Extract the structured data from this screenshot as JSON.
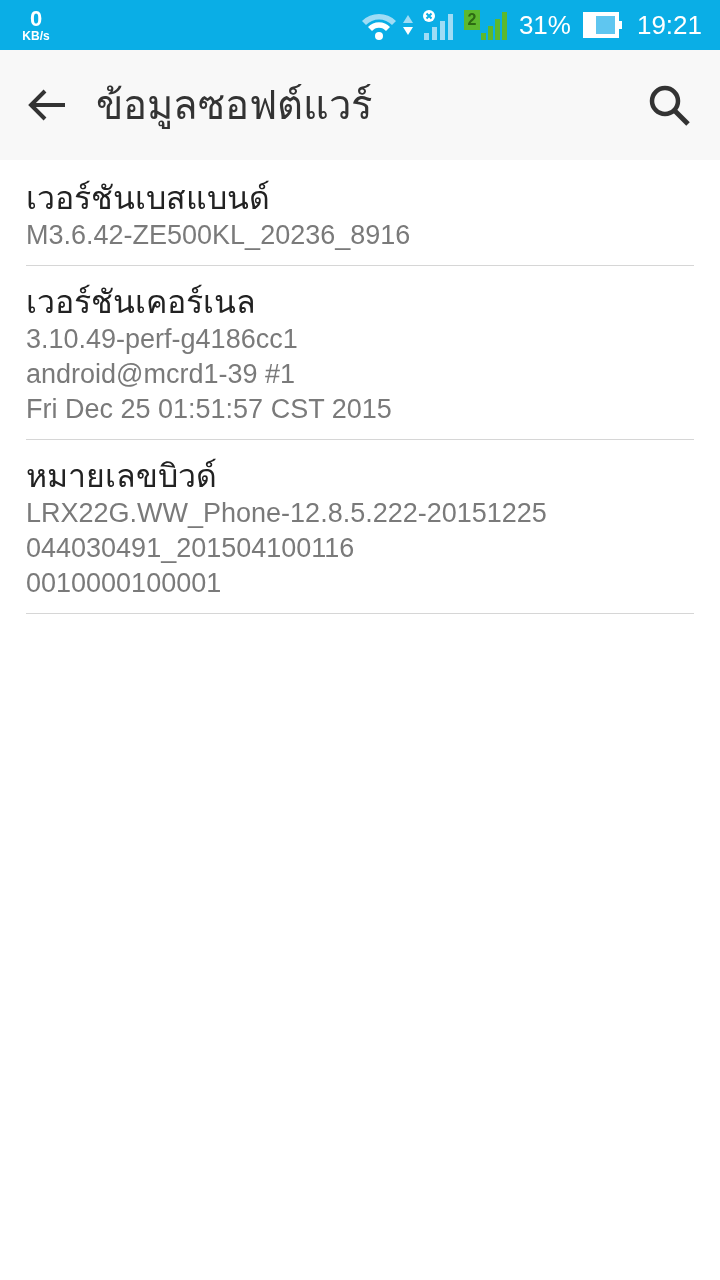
{
  "status_bar": {
    "speed_value": "0",
    "speed_unit": "KB/s",
    "sim_number": "2",
    "battery_percent": "31%",
    "time": "19:21"
  },
  "toolbar": {
    "title": "ข้อมูลซอฟต์แวร์"
  },
  "items": [
    {
      "title": "เวอร์ชันเบสแบนด์",
      "lines": [
        "M3.6.42-ZE500KL_20236_8916"
      ]
    },
    {
      "title": "เวอร์ชันเคอร์เนล",
      "lines": [
        "3.10.49-perf-g4186cc1",
        "android@mcrd1-39 #1",
        "Fri Dec 25 01:51:57 CST 2015"
      ]
    },
    {
      "title": "หมายเลขบิวด์",
      "lines": [
        "LRX22G.WW_Phone-12.8.5.222-20151225",
        "044030491_201504100116",
        "0010000100001"
      ]
    }
  ]
}
